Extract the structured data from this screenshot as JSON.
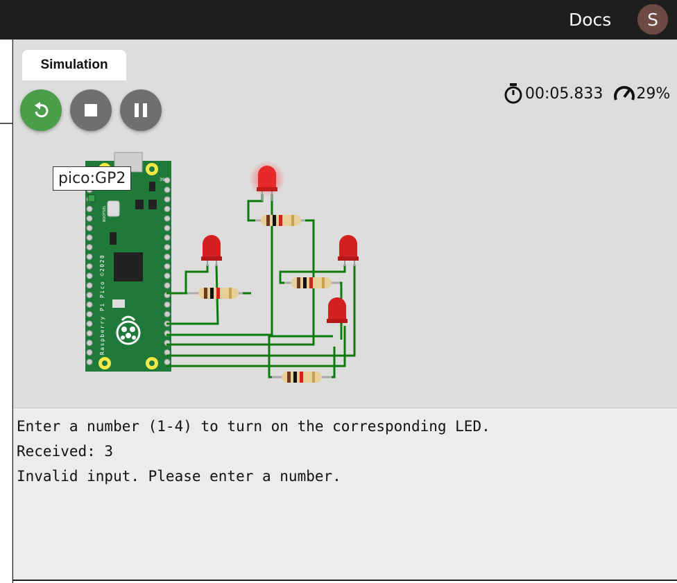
{
  "header": {
    "docs_label": "Docs",
    "avatar_initial": "S"
  },
  "simulation": {
    "tab_label": "Simulation",
    "timer": "00:05.833",
    "speed": "29%",
    "tooltip": "pico:GP2",
    "icons": [
      "restart-icon",
      "stop-icon",
      "pause-icon",
      "stopwatch-icon",
      "speedometer-icon"
    ]
  },
  "board": {
    "silkscreen_main": "Raspberry Pi Pico ©2020",
    "bootsel": "BOOTSEL",
    "pin_label": "39"
  },
  "serial_monitor": {
    "lines": [
      "Enter a number (1-4) to turn on the corresponding LED.",
      "Received: 3",
      "Invalid input. Please enter a number."
    ]
  },
  "colors": {
    "topbar": "#1e1e1e",
    "canvas": "#dddddd",
    "restart_button": "#4a9e4a",
    "control_button": "#6f6f6f",
    "pcb": "#1f7a3a",
    "wire": "#0b7a0b",
    "led": "#d42020"
  }
}
